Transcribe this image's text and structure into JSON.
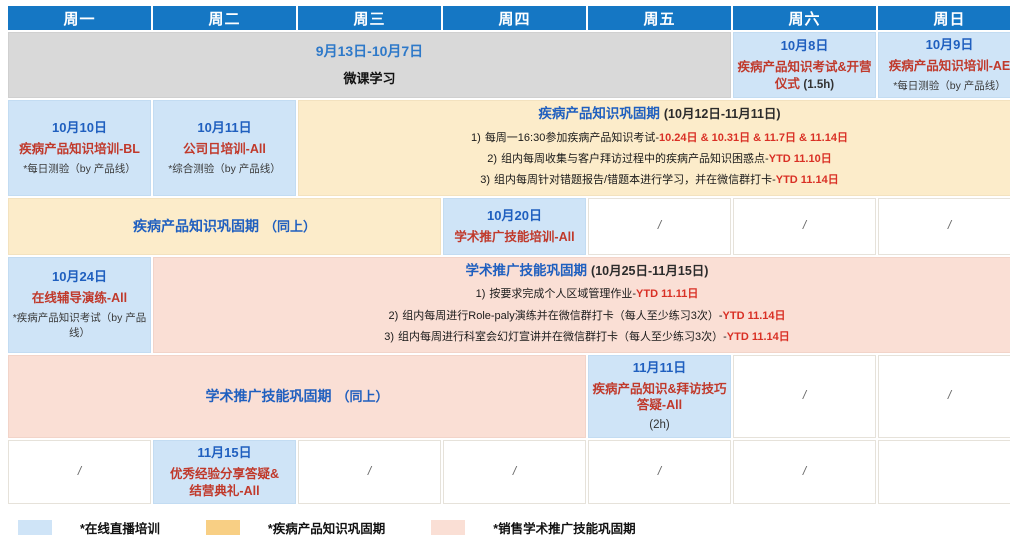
{
  "header": {
    "days": [
      "周一",
      "周二",
      "周三",
      "周四",
      "周五",
      "周六",
      "周日"
    ]
  },
  "colors": {
    "header_blue": "#1577c4",
    "live_training": "#cfe4f7",
    "knowledge_period": "#f8cf84",
    "academic_period": "#fadfd5",
    "date_text": "#1f5fbf",
    "title_text": "#c0392b",
    "highlight_red": "#d93025",
    "gray_block": "#d9d9d9"
  },
  "rows": {
    "row1": {
      "micro_course": {
        "date": "9月13日-10月7日",
        "title": "微课学习"
      },
      "sat": {
        "date": "10月8日",
        "title": "疾病产品知识考试&开营",
        "title2": "仪式",
        "duration": "(1.5h)"
      },
      "sun": {
        "date": "10月9日",
        "title": "疾病产品知识培训-AE",
        "note": "*每日测验（by 产品线）"
      }
    },
    "row2": {
      "mon": {
        "date": "10月10日",
        "title": "疾病产品知识培训-BL",
        "note": "*每日测验（by 产品线）"
      },
      "tue": {
        "date": "10月11日",
        "title": "公司日培训-All",
        "note": "*综合测验（by 产品线）"
      },
      "period": {
        "heading": "疾病产品知识巩固期",
        "range": "(10月12日-11月11日)",
        "items": [
          {
            "num": "1)",
            "text": "每周一16:30参加疾病产品知识考试-",
            "hl": "10.24日 & 10.31日 & 11.7日 & 11.14日"
          },
          {
            "num": "2)",
            "text": "组内每周收集与客户拜访过程中的疾病产品知识困惑点-",
            "hl": "YTD 11.10日"
          },
          {
            "num": "3)",
            "text": "组内每周针对错题报告/错题本进行学习，并在微信群打卡-",
            "hl": "YTD 11.14日"
          }
        ]
      }
    },
    "row3": {
      "period_same": {
        "heading": "疾病产品知识巩固期",
        "same": "（同上）"
      },
      "thu": {
        "date": "10月20日",
        "title": "学术推广技能培训-All"
      },
      "empty": [
        "/",
        "/",
        "/"
      ]
    },
    "row4": {
      "mon": {
        "date": "10月24日",
        "title": "在线辅导演练-All",
        "note": "*疾病产品知识考试（by 产品线）"
      },
      "period": {
        "heading": "学术推广技能巩固期",
        "range": "(10月25日-11月15日)",
        "items": [
          {
            "num": "1)",
            "text": "按要求完成个人区域管理作业-",
            "hl": "YTD 11.11日"
          },
          {
            "num": "2)",
            "text": "组内每周进行Role-paly演练并在微信群打卡（每人至少练习3次）-",
            "hl": "YTD 11.14日"
          },
          {
            "num": "3)",
            "text": "组内每周进行科室会幻灯宣讲并在微信群打卡（每人至少练习3次）-",
            "hl": "YTD 11.14日"
          }
        ]
      }
    },
    "row5": {
      "period_same": {
        "heading": "学术推广技能巩固期",
        "same": "（同上）"
      },
      "fri": {
        "date": "11月11日",
        "title": "疾病产品知识&拜访技巧",
        "title2": "答疑-All",
        "duration": "(2h)"
      },
      "empty": [
        "/",
        "/"
      ]
    },
    "row6": {
      "mon_empty": "/",
      "tue": {
        "date": "11月15日",
        "title": "优秀经验分享答疑&",
        "title2": "结营典礼-All"
      },
      "empty": [
        "/",
        "/",
        "/",
        "/"
      ]
    }
  },
  "legend": [
    {
      "swatch": "blue",
      "label": "*在线直播培训"
    },
    {
      "swatch": "orange",
      "label": "*疾病产品知识巩固期"
    },
    {
      "swatch": "pink",
      "label": "*销售学术推广技能巩固期"
    }
  ]
}
